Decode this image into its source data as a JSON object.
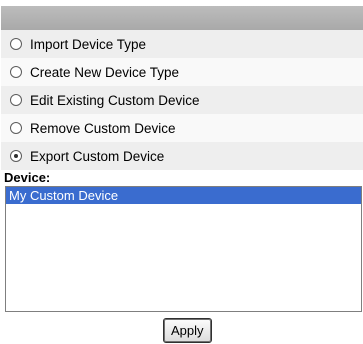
{
  "options": [
    {
      "label": "Import Device Type",
      "selected": false
    },
    {
      "label": "Create New Device Type",
      "selected": false
    },
    {
      "label": "Edit Existing Custom Device",
      "selected": false
    },
    {
      "label": "Remove Custom Device",
      "selected": false
    },
    {
      "label": "Export Custom Device",
      "selected": true
    }
  ],
  "device": {
    "label": "Device:",
    "items": [
      {
        "label": "My Custom Device",
        "selected": true
      }
    ]
  },
  "apply_label": "Apply",
  "colors": {
    "header": "#a9a9a9",
    "selection": "#3a6ccf"
  }
}
